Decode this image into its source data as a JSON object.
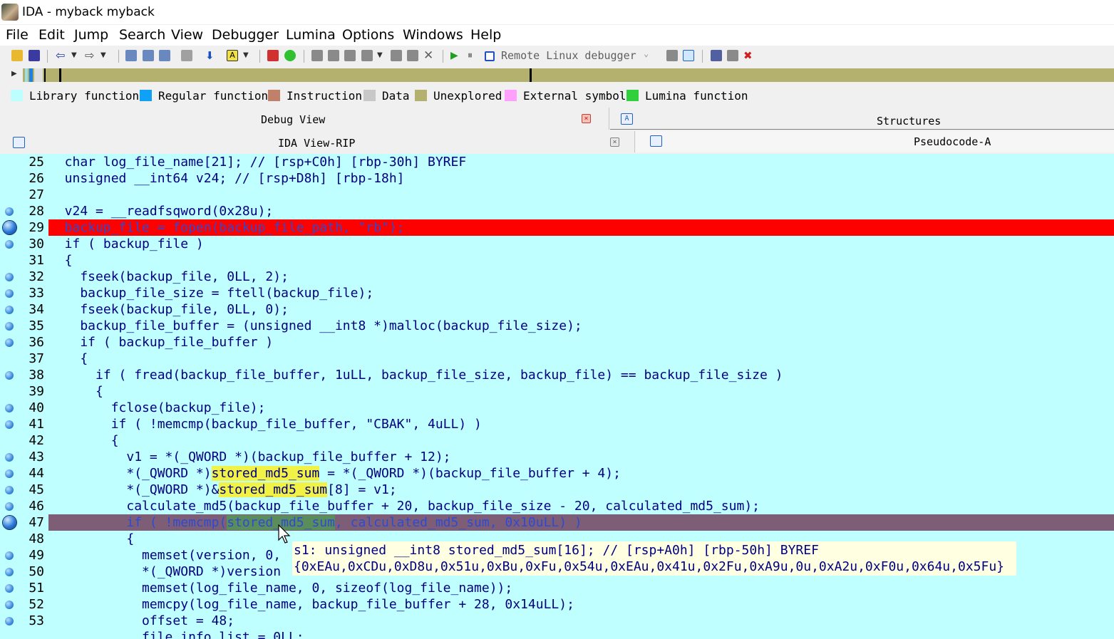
{
  "window": {
    "title": "IDA - myback myback"
  },
  "menu": [
    "File",
    "Edit",
    "Jump",
    "Search",
    "View",
    "Debugger",
    "Lumina",
    "Options",
    "Windows",
    "Help"
  ],
  "toolbar": {
    "debugger_select": "Remote Linux debugger"
  },
  "legend": [
    {
      "label": "Library function",
      "color": "#bdfeff"
    },
    {
      "label": "Regular function",
      "color": "#0fa1f5"
    },
    {
      "label": "Instruction",
      "color": "#c0806a"
    },
    {
      "label": "Data",
      "color": "#c8c8c8"
    },
    {
      "label": "Unexplored",
      "color": "#b4b06e"
    },
    {
      "label": "External symbol",
      "color": "#ffa0ff"
    },
    {
      "label": "Lumina function",
      "color": "#2fd03b"
    }
  ],
  "tabs": {
    "debug_view": "Debug View",
    "structures": "Structures",
    "ida_view": "IDA View-RIP",
    "pseudocode": "Pseudocode-A"
  },
  "code_lines": [
    {
      "n": "25",
      "bp": "none",
      "hl": "",
      "text": "  char log_file_name[21]; // [rsp+C0h] [rbp-30h] BYREF"
    },
    {
      "n": "26",
      "bp": "none",
      "hl": "",
      "text": "  unsigned __int64 v24; // [rsp+D8h] [rbp-18h]"
    },
    {
      "n": "27",
      "bp": "none",
      "hl": "",
      "text": ""
    },
    {
      "n": "28",
      "bp": "small",
      "hl": "",
      "text": "  v24 = __readfsqword(0x28u);"
    },
    {
      "n": "29",
      "bp": "big",
      "hl": "red",
      "text": "  backup_file = fopen(backup_file_path, \"rb\");"
    },
    {
      "n": "30",
      "bp": "small",
      "hl": "",
      "text": "  if ( backup_file )"
    },
    {
      "n": "31",
      "bp": "none",
      "hl": "",
      "text": "  {"
    },
    {
      "n": "32",
      "bp": "small",
      "hl": "",
      "text": "    fseek(backup_file, 0LL, 2);"
    },
    {
      "n": "33",
      "bp": "small",
      "hl": "",
      "text": "    backup_file_size = ftell(backup_file);"
    },
    {
      "n": "34",
      "bp": "small",
      "hl": "",
      "text": "    fseek(backup_file, 0LL, 0);"
    },
    {
      "n": "35",
      "bp": "small",
      "hl": "",
      "text": "    backup_file_buffer = (unsigned __int8 *)malloc(backup_file_size);"
    },
    {
      "n": "36",
      "bp": "small",
      "hl": "",
      "text": "    if ( backup_file_buffer )"
    },
    {
      "n": "37",
      "bp": "none",
      "hl": "",
      "text": "    {"
    },
    {
      "n": "38",
      "bp": "small",
      "hl": "",
      "text": "      if ( fread(backup_file_buffer, 1uLL, backup_file_size, backup_file) == backup_file_size )"
    },
    {
      "n": "39",
      "bp": "none",
      "hl": "",
      "text": "      {"
    },
    {
      "n": "40",
      "bp": "small",
      "hl": "",
      "text": "        fclose(backup_file);"
    },
    {
      "n": "41",
      "bp": "small",
      "hl": "",
      "text": "        if ( !memcmp(backup_file_buffer, \"CBAK\", 4uLL) )"
    },
    {
      "n": "42",
      "bp": "none",
      "hl": "",
      "text": "        {"
    },
    {
      "n": "43",
      "bp": "small",
      "hl": "",
      "text": "          v1 = *(_QWORD *)(backup_file_buffer + 12);"
    },
    {
      "n": "44",
      "bp": "small",
      "hl": "",
      "text": "          *(_QWORD *)stored_md5_sum = *(_QWORD *)(backup_file_buffer + 4);"
    },
    {
      "n": "45",
      "bp": "small",
      "hl": "",
      "text": "          *(_QWORD *)&stored_md5_sum[8] = v1;"
    },
    {
      "n": "46",
      "bp": "small",
      "hl": "",
      "text": "          calculate_md5(backup_file_buffer + 20, backup_file_size - 20, calculated_md5_sum);"
    },
    {
      "n": "47",
      "bp": "big",
      "hl": "purple",
      "text": "          if ( !memcmp(stored_md5_sum, calculated_md5_sum, 0x10uLL) )"
    },
    {
      "n": "48",
      "bp": "none",
      "hl": "",
      "text": "          {"
    },
    {
      "n": "49",
      "bp": "small",
      "hl": "",
      "text": "            memset(version, 0,"
    },
    {
      "n": "50",
      "bp": "small",
      "hl": "",
      "text": "            *(_QWORD *)version"
    },
    {
      "n": "51",
      "bp": "small",
      "hl": "",
      "text": "            memset(log_file_name, 0, sizeof(log_file_name));"
    },
    {
      "n": "52",
      "bp": "small",
      "hl": "",
      "text": "            memcpy(log_file_name, backup_file_buffer + 28, 0x14uLL);"
    },
    {
      "n": "53",
      "bp": "small",
      "hl": "",
      "text": "            offset = 48;"
    },
    {
      "n": "",
      "bp": "none",
      "hl": "",
      "text": "            file_info_list = 0LL;"
    }
  ],
  "tooltip": {
    "line1": "s1: unsigned __int8 stored_md5_sum[16]; // [rsp+A0h] [rbp-50h] BYREF",
    "line2": "{0xEAu,0xCDu,0xD8u,0x51u,0xBu,0xFu,0x54u,0xEAu,0x41u,0x2Fu,0xA9u,0u,0xA2u,0xF0u,0x64u,0x5Fu}"
  },
  "highlight_symbol": "stored_md5_sum",
  "colors": {
    "code_bg": "#c0ffff",
    "current_line": "#ff0000",
    "breakpoint_line": "#7e5e76",
    "symbol_highlight": "#f2f246"
  }
}
